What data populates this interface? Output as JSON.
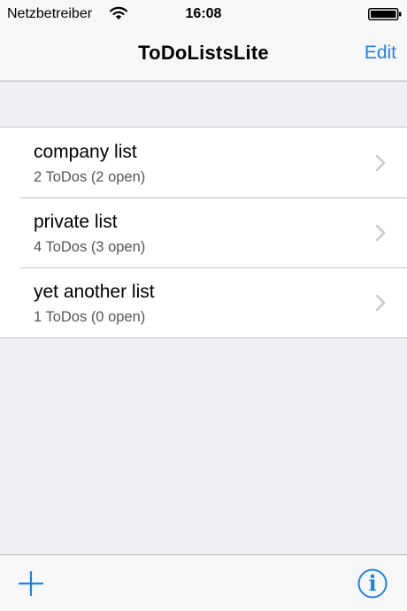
{
  "status_bar": {
    "carrier": "Netzbetreiber",
    "time": "16:08",
    "wifi_icon": "wifi-icon",
    "battery_icon": "battery-icon"
  },
  "nav": {
    "title": "ToDoListsLite",
    "edit_label": "Edit"
  },
  "lists": [
    {
      "title": "company list",
      "subtitle": "2 ToDos (2 open)"
    },
    {
      "title": "private list",
      "subtitle": "4 ToDos (3 open)"
    },
    {
      "title": "yet another list",
      "subtitle": "1 ToDos (0 open)"
    }
  ],
  "toolbar": {
    "add_icon": "plus-icon",
    "info_label": "i"
  },
  "colors": {
    "accent": "#1a83e3",
    "background": "#efeff4",
    "bar": "#f7f7f7",
    "separator": "#c8c7cc",
    "subtitle": "#555555"
  }
}
